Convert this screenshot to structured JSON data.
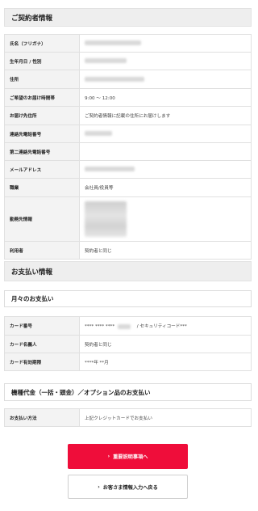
{
  "contract": {
    "header": "ご契約者情報",
    "rows": [
      {
        "label": "氏名（フリガナ）",
        "value": ""
      },
      {
        "label": "生年月日 / 性別",
        "value": ""
      },
      {
        "label": "住所",
        "value": ""
      },
      {
        "label": "ご希望のお届け時間帯",
        "value": "9:00 〜 12:00"
      },
      {
        "label": "お届け先住所",
        "value": "ご契約者情報に記載の住所にお届けします"
      },
      {
        "label": "連絡先電話番号",
        "value": ""
      },
      {
        "label": "第二連絡先電話番号",
        "value": ""
      },
      {
        "label": "メールアドレス",
        "value": ""
      },
      {
        "label": "職業",
        "value": "会社員/役員等"
      },
      {
        "label": "勤務先情報",
        "value": ""
      },
      {
        "label": "利用者",
        "value": "契約者と同じ"
      }
    ]
  },
  "payment": {
    "header": "お支払い情報",
    "monthly_header": "月々のお支払い",
    "card_rows": [
      {
        "label": "カード番号",
        "value_prefix": "**** **** ****",
        "value_suffix": "/ セキュリティコード***"
      },
      {
        "label": "カード名義人",
        "value": "契約者と同じ"
      },
      {
        "label": "カード有効期限",
        "value": "****年 **月"
      }
    ],
    "device_header": "機種代金（一括・頭金）／オプション品のお支払い",
    "device_rows": [
      {
        "label": "お支払い方法",
        "value": "上記クレジットカードでお支払い"
      }
    ]
  },
  "buttons": {
    "next_label": "重要説明事項へ",
    "back_label": "お客さま情報入力へ戻る",
    "chevron": "›",
    "primary_color": "#ef0d3a"
  }
}
